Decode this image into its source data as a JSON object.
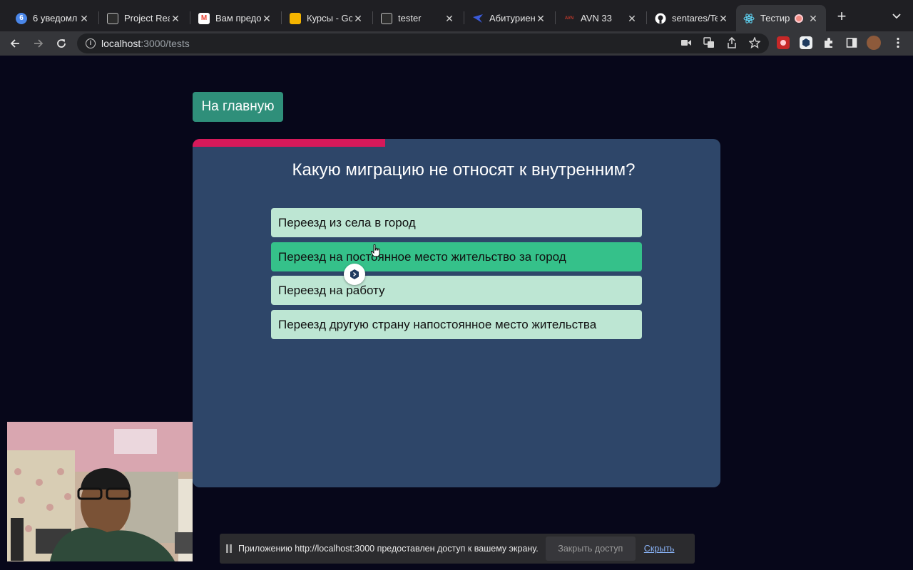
{
  "browser": {
    "tabs": [
      {
        "title": "6 уведомл",
        "icon": "badge-6",
        "icon_text": "6",
        "icon_color": "#4a86e8"
      },
      {
        "title": "Project Rea",
        "icon": "page-icon",
        "icon_text": "",
        "icon_color": "#cfcfcf"
      },
      {
        "title": "Вам предо",
        "icon": "gmail-icon",
        "icon_text": "M",
        "icon_color": "#ea4335"
      },
      {
        "title": "Курсы - Go",
        "icon": "slides-icon",
        "icon_text": "",
        "icon_color": "#f4b400"
      },
      {
        "title": "tester",
        "icon": "page-icon",
        "icon_text": "",
        "icon_color": "#cfcfcf"
      },
      {
        "title": "Абитуриен",
        "icon": "university-icon",
        "icon_text": "",
        "icon_color": "#3b5bdb"
      },
      {
        "title": "AVN 33",
        "icon": "avn-icon",
        "icon_text": "AVN",
        "icon_color": "#c0392b"
      },
      {
        "title": "sentares/Te",
        "icon": "github-icon",
        "icon_text": "",
        "icon_color": "#ffffff"
      },
      {
        "title": "Тестир",
        "icon": "react-icon",
        "icon_text": "",
        "icon_color": "#61dafb",
        "active": true
      }
    ],
    "close_glyph": "✕",
    "new_tab_glyph": "+",
    "url_host": "localhost",
    "url_path": ":3000/tests"
  },
  "page": {
    "home_button": "На главную",
    "progress_fraction": 0.365,
    "progress_color": "#d6195a",
    "question": "Какую миграцию не относят к внутренним?",
    "answers": [
      {
        "text": "Переезд из села в город",
        "selected": false
      },
      {
        "text": "Переезд на постоянное место жительство за город",
        "selected": true
      },
      {
        "text": "Переезд на работу",
        "selected": false
      },
      {
        "text": "Переезд другую страну напостоянное место жительства",
        "selected": false
      }
    ]
  },
  "screen_share": {
    "message": "Приложению http://localhost:3000 предоставлен доступ к вашему экрану.",
    "stop_label": "Закрыть доступ",
    "hide_label": "Скрыть"
  }
}
